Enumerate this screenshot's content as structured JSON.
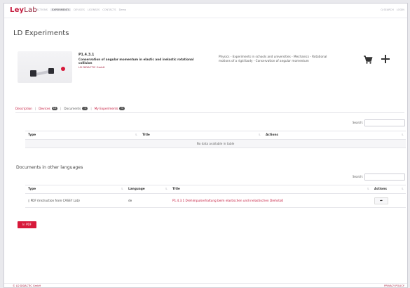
{
  "app": {
    "logo_main": "Ley",
    "logo_sub": "Lab"
  },
  "nav": {
    "items": [
      "ACTIONS",
      "EXPERIMENTS",
      "DEVICES",
      "LICENSES",
      "CONTACTS",
      "Demo"
    ],
    "active_index": 1
  },
  "tools": {
    "search": "Q SEARCH",
    "login": "LOGIN"
  },
  "page": {
    "title": "LD Experiments"
  },
  "product": {
    "code": "P1.4.3.1",
    "name": "Conservation of angular momentum in elastic and inelastic rotational collision",
    "maker": "LD DIDACTIC GmbH",
    "category": "Physics - Experiments in schools and universities - Mechanics - Rotational motions of a rigid body - Conservation of angular momentum",
    "cart_icon": "cart-icon",
    "add_icon": "plus-icon"
  },
  "tabs": [
    {
      "label": "Description",
      "badge": null
    },
    {
      "label": "Devices",
      "badge": "10"
    },
    {
      "label": "Documents",
      "badge": "1"
    },
    {
      "label": "My Experiments",
      "badge": "0"
    }
  ],
  "table1": {
    "search_label": "Search:",
    "columns": [
      "Type",
      "Title",
      "Actions"
    ],
    "empty_text": "No data available in table"
  },
  "section2": {
    "title": "Documents in other languages"
  },
  "table2": {
    "search_label": "Search:",
    "columns": [
      "Type",
      "Language",
      "Title",
      "Actions"
    ],
    "rows": [
      {
        "type": "PDF (Instruction from CASSY Lab)",
        "language": "de",
        "title": "P1.4.3.1 Drehimpulserhaltung beim elastischen und inelastischen Drehstoß",
        "action_icon": "share-icon"
      }
    ]
  },
  "buttons": {
    "pdf": "In PDF"
  },
  "footer": {
    "left": "© LD DIDACTIC GmbH",
    "right": "PRIVACY POLICY"
  },
  "colors": {
    "accent": "#d7193a",
    "brand": "#c4163a"
  }
}
